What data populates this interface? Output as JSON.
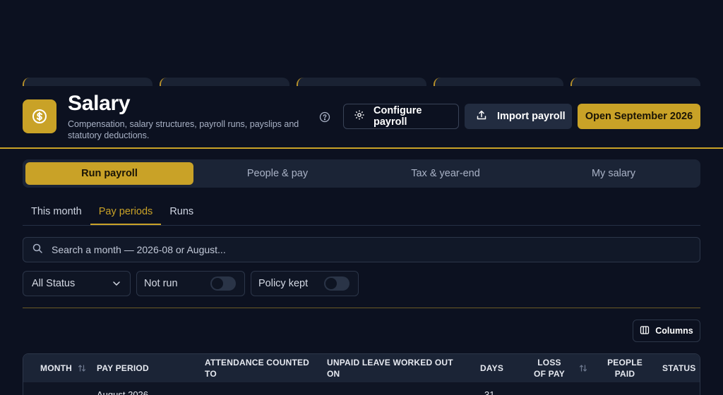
{
  "header": {
    "title": "Salary",
    "subtitle": "Compensation, salary structures, payroll runs, payslips and statutory deductions.",
    "buttons": {
      "configure": "Configure payroll",
      "import": "Import payroll",
      "open": "Open September 2026"
    }
  },
  "main_tabs": [
    {
      "label": "Run payroll",
      "active": true
    },
    {
      "label": "People & pay",
      "active": false
    },
    {
      "label": "Tax & year-end",
      "active": false
    },
    {
      "label": "My salary",
      "active": false
    }
  ],
  "sub_tabs": [
    {
      "label": "This month",
      "active": false
    },
    {
      "label": "Pay periods",
      "active": true
    },
    {
      "label": "Runs",
      "active": false
    }
  ],
  "search": {
    "placeholder": "Search a month — 2026-08 or August..."
  },
  "filters": {
    "status": "All Status",
    "not_run": {
      "label": "Not run",
      "on": false
    },
    "policy_kept": {
      "label": "Policy kept",
      "on": false
    }
  },
  "columns_button": "Columns",
  "table": {
    "headers": {
      "month": "Month",
      "pay_period": "Pay period",
      "attendance": "Attendance counted to",
      "unpaid_leave": "Unpaid leave worked out on",
      "days": "Days",
      "loss_of_pay": "Loss of pay",
      "people_paid": "People paid",
      "status": "Status"
    },
    "rows": [
      {
        "pay_period": "August 2026",
        "days": "31"
      }
    ]
  },
  "colors": {
    "accent": "#c9a227",
    "background": "#0c1120",
    "surface": "#1b2436"
  }
}
